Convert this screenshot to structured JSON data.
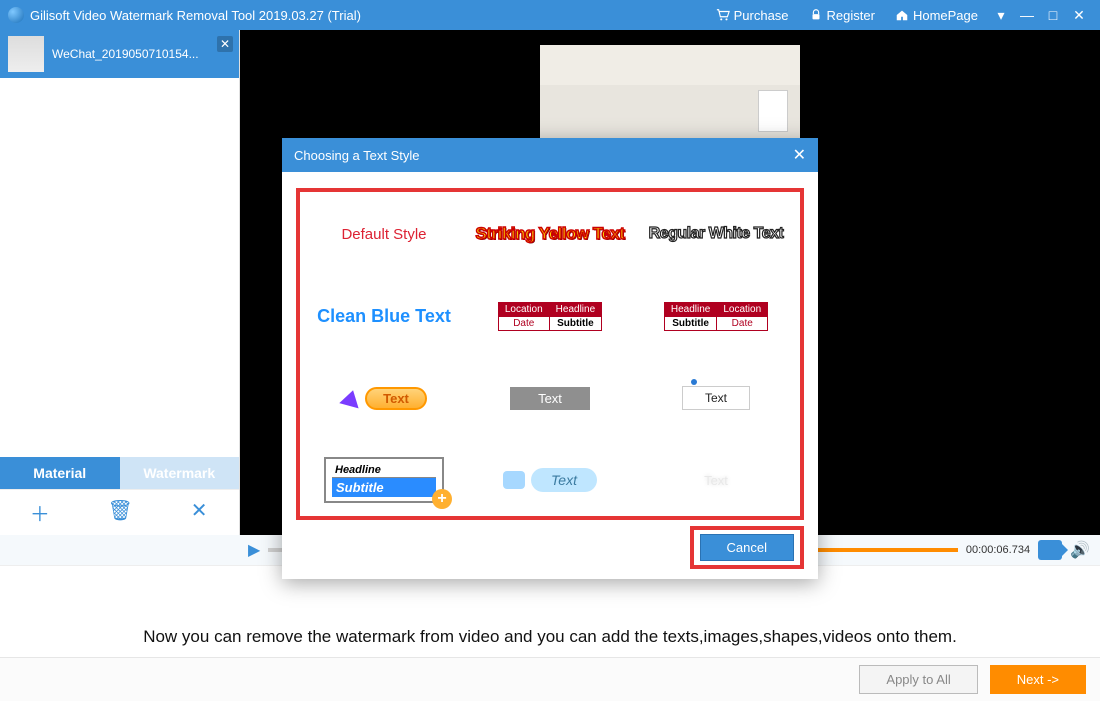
{
  "titlebar": {
    "title": "Gilisoft Video Watermark Removal Tool 2019.03.27 (Trial)",
    "links": {
      "purchase": "Purchase",
      "register": "Register",
      "homepage": "HomePage"
    }
  },
  "file": {
    "name": "WeChat_2019050710154..."
  },
  "sidebar_tabs": {
    "material": "Material",
    "watermark": "Watermark"
  },
  "time": "00:00:06.734",
  "modal": {
    "title": "Choosing a Text Style",
    "styles": {
      "default": "Default Style",
      "striking_yellow": "Striking Yellow Text",
      "regular_white": "Regular White Text",
      "clean_blue": "Clean Blue Text",
      "table_a": {
        "location": "Location",
        "headline": "Headline",
        "date": "Date",
        "subtitle": "Subtitle"
      },
      "table_b": {
        "headline": "Headline",
        "location": "Location",
        "subtitle": "Subtitle",
        "date": "Date"
      },
      "orange_text": "Text",
      "gray_text": "Text",
      "white_text": "Text",
      "hs": {
        "headline": "Headline",
        "subtitle": "Subtitle"
      },
      "cloud_text": "Text",
      "faint_text": "Text"
    },
    "cancel": "Cancel"
  },
  "tip": "Now you can remove the watermark from video and you can add the texts,images,shapes,videos onto them.",
  "buttons": {
    "apply_all": "Apply to All",
    "next": "Next ->"
  }
}
